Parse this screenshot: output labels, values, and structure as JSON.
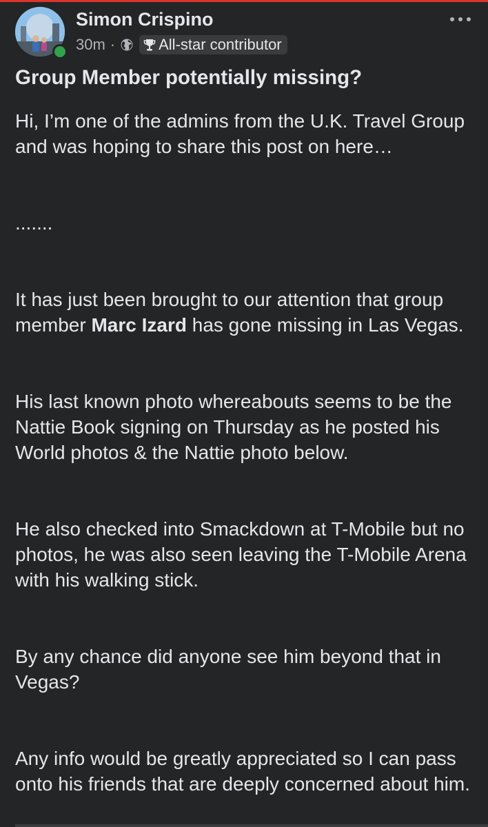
{
  "post": {
    "author": "Simon Crispino",
    "time": "30m",
    "separator": "·",
    "audience_icon": "globe-icon",
    "badge": "All-star contributor",
    "badge_icon": "trophy-icon",
    "more_icon": "more-options-icon",
    "title": "Group Member potentially missing?",
    "paragraphs": {
      "p1": "Hi, I’m one of the admins from the U.K. Travel Group and was hoping to share this post on here…",
      "p2": ".......",
      "p3_before": "It has just been brought to our attention that group member ",
      "p3_bold": "Marc Izard",
      "p3_after": " has gone missing in Las Vegas.",
      "p4": "His last known photo whereabouts seems to be the Nattie Book signing on Thursday as he posted his World photos & the Nattie photo below.",
      "p5": "He also checked into Smackdown at T-Mobile but no photos, he was also seen leaving the T-Mobile Arena with his walking stick.",
      "p6": "By any chance did anyone see him beyond that in Vegas?",
      "p7": "Any info would be greatly appreciated so I can pass onto his friends that are deeply concerned about him."
    }
  },
  "colors": {
    "background": "#242526",
    "text_primary": "#e4e6eb",
    "text_secondary": "#b0b3b8",
    "online": "#31a24c",
    "badge_bg": "#3a3b3c"
  }
}
